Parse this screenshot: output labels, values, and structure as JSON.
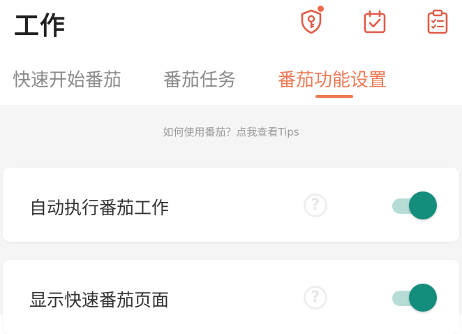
{
  "header": {
    "title": "工作",
    "icons": [
      {
        "name": "shield-key-icon",
        "has_badge": true
      },
      {
        "name": "calendar-check-icon"
      },
      {
        "name": "clipboard-list-icon"
      }
    ],
    "badge_color": "#ee6b4d",
    "icon_color": "#e05a47"
  },
  "tabs": [
    {
      "label": "快速开始番茄",
      "active": false
    },
    {
      "label": "番茄任务",
      "active": false
    },
    {
      "label": "番茄功能设置",
      "active": true
    }
  ],
  "accent_color": "#f07a55",
  "tips": "如何使用番茄？点我查看Tips",
  "settings": [
    {
      "label": "自动执行番茄工作",
      "enabled": true
    },
    {
      "label": "显示快速番茄页面",
      "enabled": true
    }
  ],
  "toggle_color": "#138d7c"
}
